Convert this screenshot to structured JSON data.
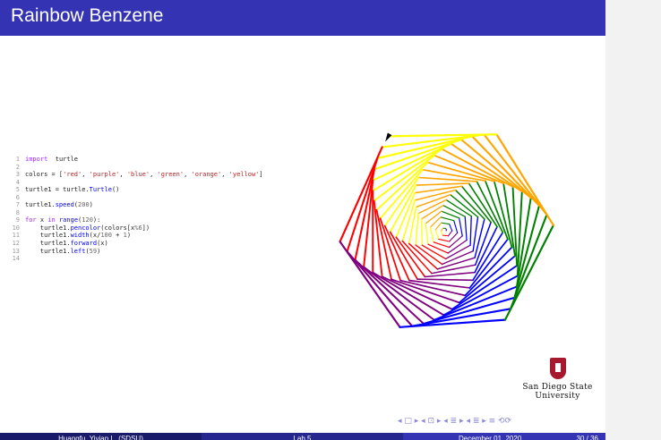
{
  "slide_title": "Rainbow Benzene",
  "code_lines": [
    {
      "n": "1",
      "parts": [
        [
          "kw",
          "import"
        ],
        [
          "",
          "  turtle"
        ]
      ]
    },
    {
      "n": "2",
      "parts": []
    },
    {
      "n": "3",
      "parts": [
        [
          "",
          "colors = ["
        ],
        [
          "str",
          "'red'"
        ],
        [
          "",
          ", "
        ],
        [
          "str",
          "'purple'"
        ],
        [
          "",
          ", "
        ],
        [
          "str",
          "'blue'"
        ],
        [
          "",
          ", "
        ],
        [
          "str",
          "'green'"
        ],
        [
          "",
          ", "
        ],
        [
          "str",
          "'orange'"
        ],
        [
          "",
          ", "
        ],
        [
          "str",
          "'yellow'"
        ],
        [
          "",
          "]"
        ]
      ]
    },
    {
      "n": "4",
      "parts": []
    },
    {
      "n": "5",
      "parts": [
        [
          "",
          "turtle1 = turtle."
        ],
        [
          "fn",
          "Turtle"
        ],
        [
          "",
          "()"
        ]
      ]
    },
    {
      "n": "6",
      "parts": []
    },
    {
      "n": "7",
      "parts": [
        [
          "",
          "turtle1."
        ],
        [
          "fn",
          "speed"
        ],
        [
          "",
          "("
        ],
        [
          "num",
          "200"
        ],
        [
          "",
          ")"
        ]
      ]
    },
    {
      "n": "8",
      "parts": []
    },
    {
      "n": "9",
      "parts": [
        [
          "kw",
          "for"
        ],
        [
          "",
          " x "
        ],
        [
          "kw",
          "in"
        ],
        [
          "",
          ""
        ],
        [
          "fn",
          " range"
        ],
        [
          "",
          "("
        ],
        [
          "num",
          "120"
        ],
        [
          "",
          "):"
        ]
      ]
    },
    {
      "n": "10",
      "parts": [
        [
          "",
          "    turtle1."
        ],
        [
          "fn",
          "pencolor"
        ],
        [
          "",
          "(colors[x"
        ],
        [
          "num",
          "%6"
        ],
        [
          "",
          "])"
        ]
      ]
    },
    {
      "n": "11",
      "parts": [
        [
          "",
          "    turtle1."
        ],
        [
          "fn",
          "width"
        ],
        [
          "",
          "(x/"
        ],
        [
          "num",
          "100"
        ],
        [
          "",
          " + "
        ],
        [
          "num",
          "1"
        ],
        [
          "",
          ")"
        ]
      ]
    },
    {
      "n": "12",
      "parts": [
        [
          "",
          "    turtle1."
        ],
        [
          "fn",
          "forward"
        ],
        [
          "",
          "(x)"
        ]
      ]
    },
    {
      "n": "13",
      "parts": [
        [
          "",
          "    turtle1."
        ],
        [
          "fn",
          "left"
        ],
        [
          "",
          "("
        ],
        [
          "num",
          "59"
        ],
        [
          "",
          ")"
        ]
      ]
    },
    {
      "n": "14",
      "parts": []
    }
  ],
  "turtle": {
    "colors": [
      "#ff0000",
      "#800080",
      "#0000ff",
      "#008000",
      "#ffa500",
      "#ffff00"
    ],
    "iterations": 120,
    "turn_degrees": 59
  },
  "logo": {
    "line1": "San Diego State",
    "line2": "University"
  },
  "nav_symbols": "◂ □ ▸   ◂ ⊡ ▸   ◂ ≣ ▸   ◂ ≣ ▸    ≡    ⟲⟳",
  "footer": {
    "author": "Huangfu, Yiyian L. (SDSU)",
    "topic": "Lab 5",
    "date": "December 01, 2020",
    "page": "30 / 36"
  }
}
